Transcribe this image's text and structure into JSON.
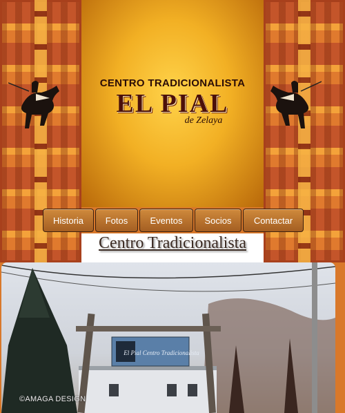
{
  "logo": {
    "top_text": "CENTRO TRADICIONALISTA",
    "main_text": "EL PIAL",
    "sub_text": "de Zelaya"
  },
  "nav": {
    "items": [
      {
        "label": "Historia"
      },
      {
        "label": "Fotos"
      },
      {
        "label": "Eventos"
      },
      {
        "label": "Socios"
      },
      {
        "label": "Contactar"
      }
    ]
  },
  "page_heading": "Centro Tradicionalista",
  "photo": {
    "sign_text": "El Pial Centro Tradicionalista"
  },
  "watermark": "©AMAGA DESIGN",
  "colors": {
    "accent": "#d9782a",
    "gold": "#f2b024",
    "nav_button": "#b86d2c",
    "dark_brown": "#4b100a"
  }
}
